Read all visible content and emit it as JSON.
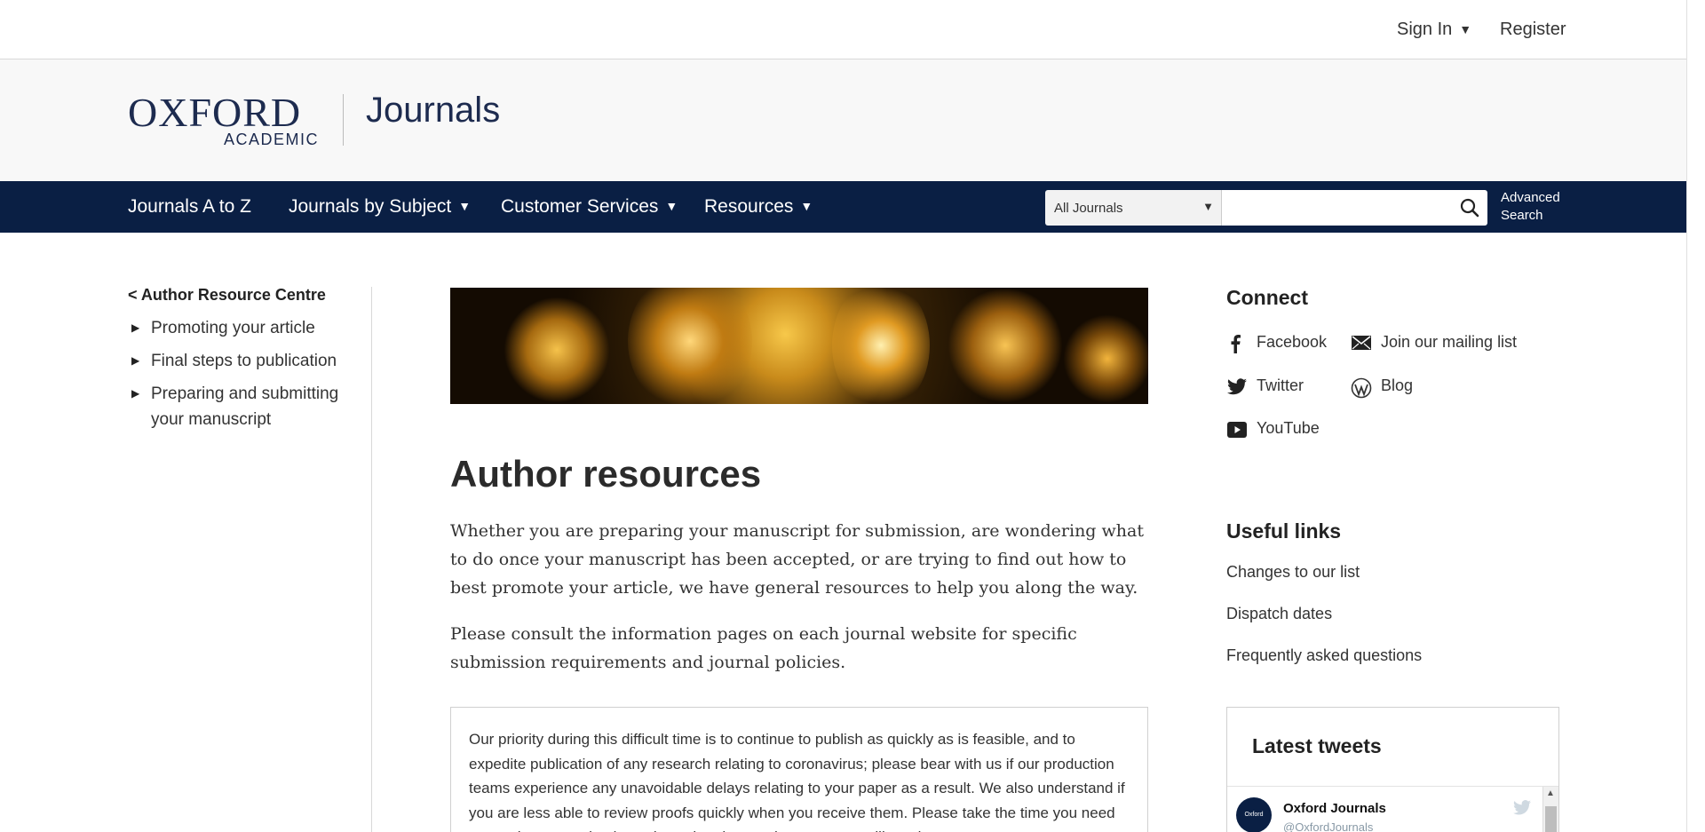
{
  "topbar": {
    "sign_in": "Sign In",
    "register": "Register"
  },
  "brand": {
    "logo_main": "OXFORD",
    "logo_sub": "ACADEMIC",
    "site_name": "Journals",
    "color": "#1d2b4f"
  },
  "nav": {
    "items": [
      {
        "label": "Journals A to Z",
        "dropdown": false
      },
      {
        "label": "Journals by Subject",
        "dropdown": true
      },
      {
        "label": "Customer Services",
        "dropdown": true
      },
      {
        "label": "Resources",
        "dropdown": true
      }
    ],
    "scope_selected": "All Journals",
    "search_placeholder": "",
    "advanced_search_line1": "Advanced",
    "advanced_search_line2": "Search",
    "background": "#0a1f44"
  },
  "sidebar": {
    "back_link": "< Author Resource Centre",
    "items": [
      {
        "label": "Promoting your article"
      },
      {
        "label": "Final steps to publication"
      },
      {
        "label": "Preparing and submitting your manuscript"
      }
    ]
  },
  "main": {
    "title": "Author resources",
    "paragraphs": [
      "Whether you are preparing your manuscript for submission, are wondering what to do once your manuscript has been accepted, or are trying to find out how to best promote your article, we have general resources to help you along the way.",
      "Please consult the information pages on each journal website for specific submission requirements and journal policies."
    ],
    "notice": "Our priority during this difficult time is to continue to publish as quickly as is feasible, and to expedite publication of any research relating to coronavirus; please bear with us if our production teams experience any unavoidable delays relating to your paper as a result. We also understand if you are less able to review proofs quickly when you receive them. Please take the time you need—you do not need to let us know in advance, however you will continue to see"
  },
  "connect": {
    "title": "Connect",
    "links": [
      {
        "label": "Facebook",
        "icon": "facebook-icon"
      },
      {
        "label": "Join our mailing list",
        "icon": "mail-icon"
      },
      {
        "label": "Twitter",
        "icon": "twitter-icon"
      },
      {
        "label": "Blog",
        "icon": "wordpress-icon"
      },
      {
        "label": "YouTube",
        "icon": "youtube-icon"
      }
    ]
  },
  "useful_links": {
    "title": "Useful links",
    "links": [
      {
        "label": "Changes to our list"
      },
      {
        "label": "Dispatch dates"
      },
      {
        "label": "Frequently asked questions"
      }
    ]
  },
  "tweets": {
    "title": "Latest tweets",
    "account_name": "Oxford Journals",
    "account_handle": "@OxfordJournals",
    "avatar_text": "Oxford Journals"
  }
}
